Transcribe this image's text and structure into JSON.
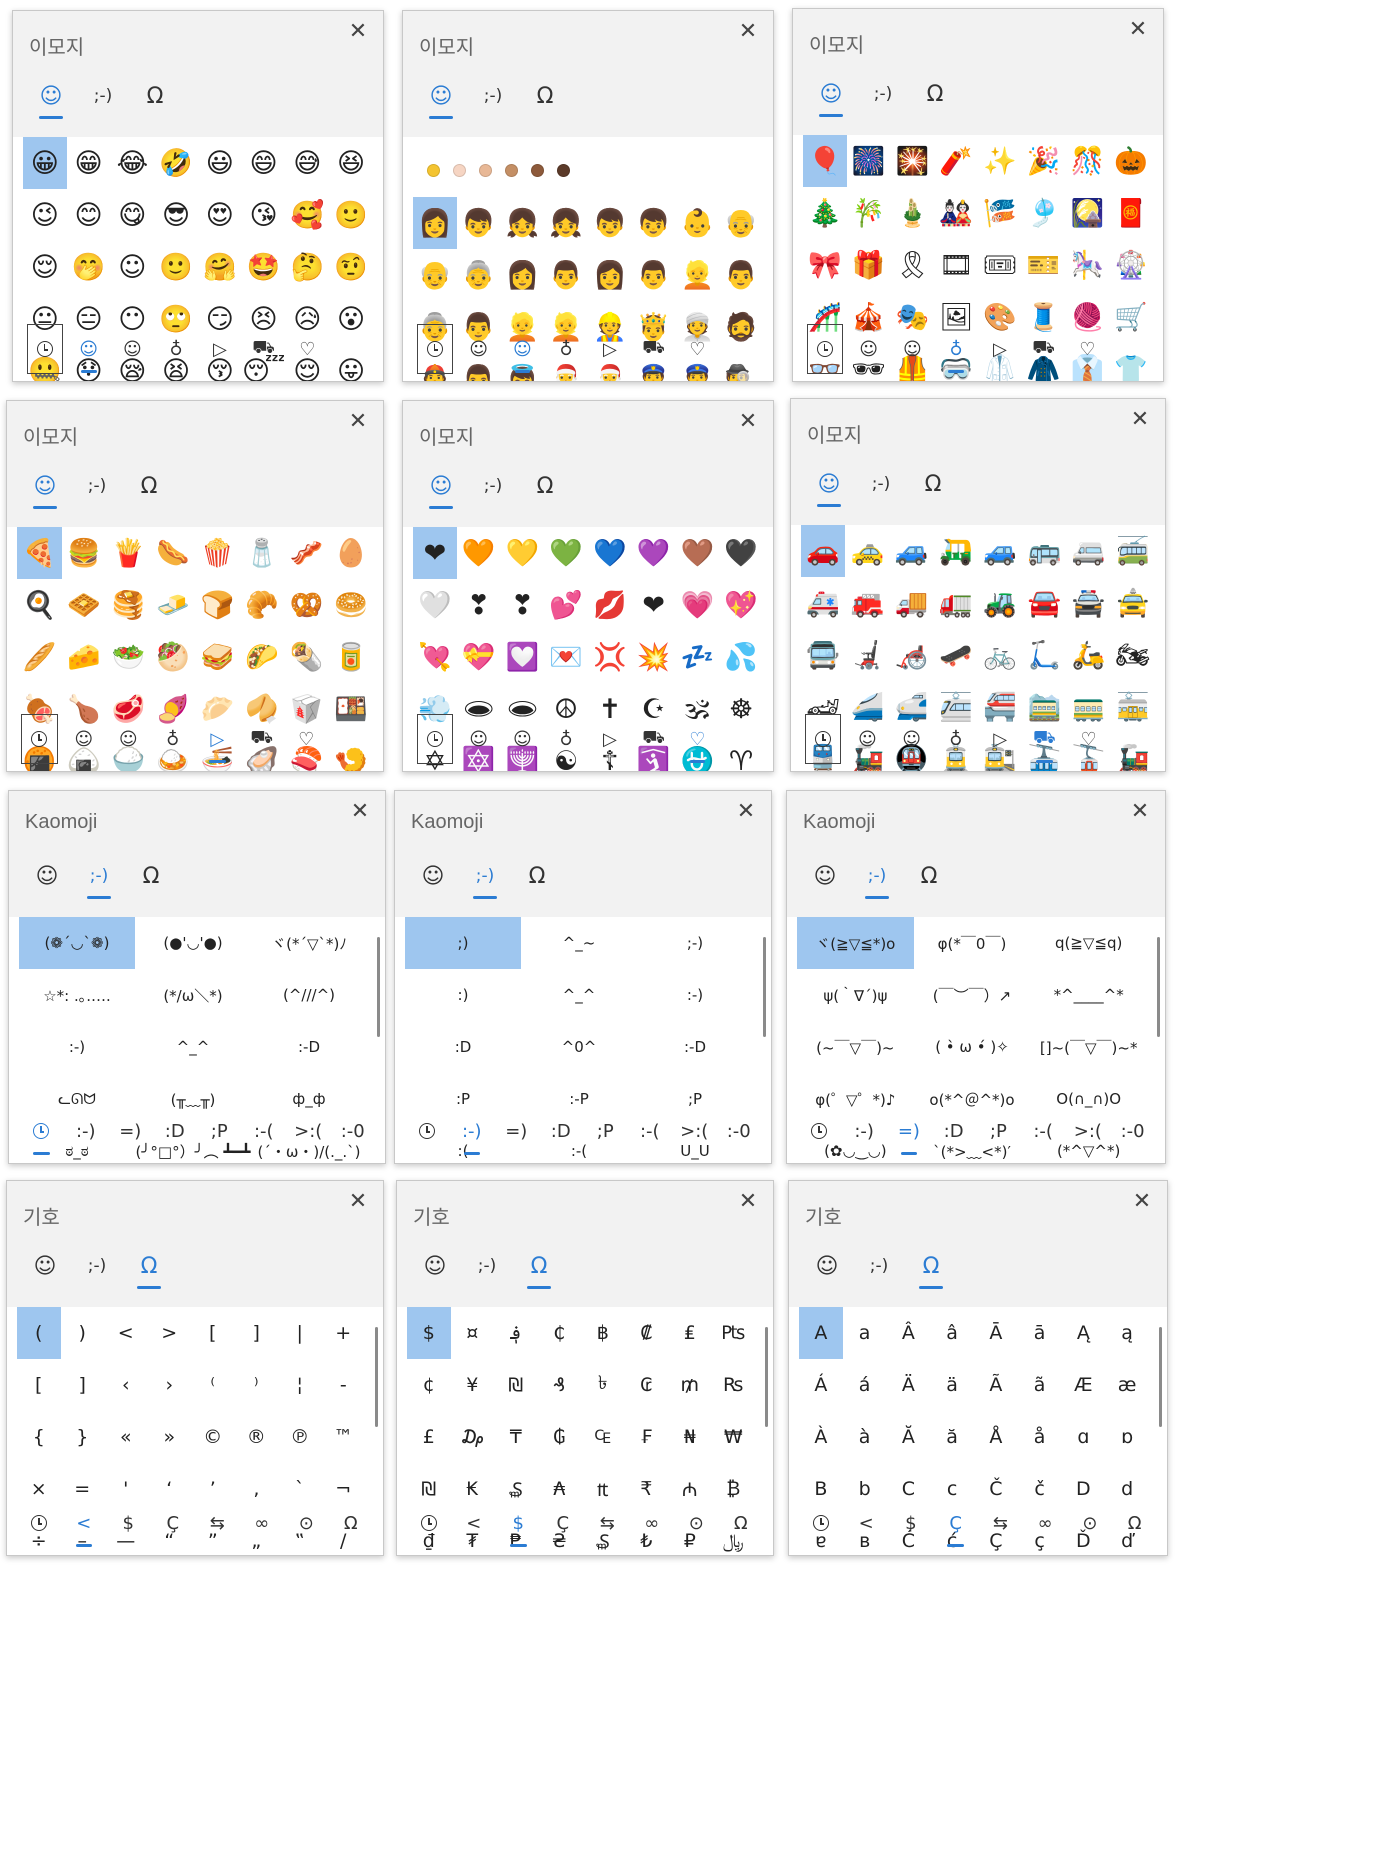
{
  "colors": {
    "accent": "#2b7cd3",
    "selected": "#9ec6ef"
  },
  "tabs": {
    "emoji_icon": "☺",
    "kaomoji_label": ";-)",
    "symbols_icon": "Ω"
  },
  "emoji_categories": [
    "recent-clock-icon",
    "smiley-icon",
    "person-icon",
    "balloon-icon",
    "pizza-icon",
    "car-icon",
    "heart-icon"
  ],
  "emoji_category_glyphs": [
    "",
    "☺",
    "☺",
    "♁",
    "▷",
    "⛟",
    "♡"
  ],
  "skin_tones": [
    "#f4c430",
    "#f6d5c3",
    "#e8b896",
    "#c48f65",
    "#8d5a3b",
    "#5b3a29"
  ],
  "kaomoji_categories": [
    "",
    ":-)",
    "=)",
    ":D",
    ";P",
    ":-(",
    ">:(",
    ":-0"
  ],
  "symbol_categories": [
    "",
    "<",
    "$",
    "Ç",
    "⇆",
    "∞",
    "⊙",
    "Ω"
  ],
  "panels": [
    {
      "title": "이모지",
      "tab": "emoji",
      "cat": 1,
      "tones": false,
      "rows": [
        [
          "😀",
          "😁",
          "😂",
          "🤣",
          "😃",
          "😄",
          "😅",
          "😆"
        ],
        [
          "😉",
          "😊",
          "😋",
          "😎",
          "😍",
          "😘",
          "🥰",
          "🙂"
        ],
        [
          "😌",
          "🤭",
          "☺",
          "🙂",
          "🤗",
          "🤩",
          "🤔",
          "🤨"
        ],
        [
          "😐",
          "😑",
          "😶",
          "🙄",
          "😏",
          "😣",
          "😥",
          "😮"
        ],
        [
          "🤐",
          "😯",
          "😪",
          "😫",
          "😚",
          "😴",
          "😌",
          "😛"
        ]
      ]
    },
    {
      "title": "이모지",
      "tab": "emoji",
      "cat": 2,
      "tones": true,
      "rows": [
        [
          "👩",
          "👦",
          "👧",
          "👧",
          "👦",
          "👦",
          "👶",
          "👴"
        ],
        [
          "👴",
          "👵",
          "👩",
          "👨",
          "👩",
          "👨",
          "👱",
          "👨"
        ],
        [
          "👵",
          "👨",
          "👱",
          "👱",
          "👷",
          "🤴",
          "👳",
          "🧔"
        ],
        [
          "👲",
          "👨",
          "👼",
          "🎅",
          "🎅",
          "👮",
          "👮",
          "🕵"
        ]
      ]
    },
    {
      "title": "이모지",
      "tab": "emoji",
      "cat": 3,
      "tones": false,
      "rows": [
        [
          "🎈",
          "🎆",
          "🎇",
          "🧨",
          "✨",
          "🎉",
          "🎊",
          "🎃"
        ],
        [
          "🎄",
          "🎋",
          "🎍",
          "🎎",
          "🎏",
          "🎐",
          "🎑",
          "🧧"
        ],
        [
          "🎀",
          "🎁",
          "🎗",
          "🎞",
          "🎟",
          "🎫",
          "🎠",
          "🎡"
        ],
        [
          "🎢",
          "🎪",
          "🎭",
          "🖼",
          "🎨",
          "🧵",
          "🧶",
          "🛒"
        ],
        [
          "👓",
          "🕶",
          "🦺",
          "🥽",
          "🥼",
          "🧥",
          "👔",
          "👕"
        ]
      ]
    },
    {
      "title": "이모지",
      "tab": "emoji",
      "cat": 4,
      "tones": false,
      "rows": [
        [
          "🍕",
          "🍔",
          "🍟",
          "🌭",
          "🍿",
          "🧂",
          "🥓",
          "🥚"
        ],
        [
          "🍳",
          "🧇",
          "🥞",
          "🧈",
          "🍞",
          "🥐",
          "🥨",
          "🥯"
        ],
        [
          "🥖",
          "🧀",
          "🥗",
          "🥙",
          "🥪",
          "🌮",
          "🌯",
          "🥫"
        ],
        [
          "🍖",
          "🍗",
          "🥩",
          "🍠",
          "🥟",
          "🥠",
          "🥡",
          "🍱"
        ],
        [
          "🍘",
          "🍙",
          "🍚",
          "🍛",
          "🍜",
          "🦪",
          "🍣",
          "🍤"
        ]
      ]
    },
    {
      "title": "이모지",
      "tab": "emoji",
      "cat": 6,
      "tones": false,
      "rows": [
        [
          "❤",
          "🧡",
          "💛",
          "💚",
          "💙",
          "💜",
          "🤎",
          "🖤"
        ],
        [
          "🤍",
          "❣",
          "❣",
          "💕",
          "💋",
          "❤",
          "💗",
          "💖"
        ],
        [
          "💘",
          "💝",
          "💟",
          "💌",
          "💢",
          "💥",
          "💤",
          "💦"
        ],
        [
          "💨",
          "🕳",
          "🕳",
          "☮",
          "✝",
          "☪",
          "🕉",
          "☸"
        ],
        [
          "✡",
          "🔯",
          "🕎",
          "☯",
          "☦",
          "🛐",
          "⛎",
          "♈"
        ]
      ]
    },
    {
      "title": "이모지",
      "tab": "emoji",
      "cat": 5,
      "tones": false,
      "rows": [
        [
          "🚗",
          "🚕",
          "🚙",
          "🛺",
          "🚙",
          "🚌",
          "🚐",
          "🚎"
        ],
        [
          "🚑",
          "🚒",
          "🚚",
          "🚛",
          "🚜",
          "🚘",
          "🚔",
          "🚖"
        ],
        [
          "🚍",
          "🦼",
          "🦽",
          "🛹",
          "🚲",
          "🛴",
          "🛵",
          "🏍"
        ],
        [
          "🏎",
          "🚄",
          "🚅",
          "🚈",
          "🚝",
          "🚞",
          "🚃",
          "🚋"
        ],
        [
          "🚆",
          "🚂",
          "🚇",
          "🚊",
          "🚉",
          "🚠",
          "🚡",
          "🚂"
        ]
      ]
    },
    {
      "title": "Kaomoji",
      "tab": "kaomoji",
      "cat": 0,
      "rows": [
        [
          "(❁´◡`❁)",
          "(●'◡'●)",
          "ヾ(*´▽`*)ﾉ"
        ],
        [
          "☆*: .｡.….",
          "(*/ω＼*)",
          "(^///^)"
        ],
        [
          ":-)",
          "^_^",
          ":-D"
        ],
        [
          "ᓚᘏᗢ",
          "(╥﹏╥)",
          "ф_ф"
        ],
        [
          "ಠ_ಠ",
          "(╯°□°）╯︵ ┻━┻",
          "(ˊ・ω・)/(._.`)"
        ]
      ]
    },
    {
      "title": "Kaomoji",
      "tab": "kaomoji",
      "cat": 1,
      "rows": [
        [
          ";)",
          "^_~",
          ";-)"
        ],
        [
          ":)",
          "^_^",
          ":-)"
        ],
        [
          ":D",
          "^0^",
          ":-D"
        ],
        [
          ":P",
          ":-P",
          ";P"
        ],
        [
          ":(",
          ":-(",
          "U_U"
        ]
      ]
    },
    {
      "title": "Kaomoji",
      "tab": "kaomoji",
      "cat": 2,
      "rows": [
        [
          "ヾ(≧▽≦*)o",
          "φ(*￣0￣)",
          "q(≧▽≦q)"
        ],
        [
          "ψ(｀∇´)ψ",
          "(￣︶￣）↗",
          "*^____^*"
        ],
        [
          "(~￣▽￣)~",
          "( •̀ ω •́ )✧",
          "[]~(￣▽￣)~*"
        ],
        [
          "φ(゜▽゜*)♪",
          "o(*^＠^*)o",
          "O(∩_∩)O"
        ],
        [
          "(✿◡‿◡)",
          "`(*>﹏<*)′",
          "(*^▽^*)"
        ]
      ]
    },
    {
      "title": "기호",
      "tab": "symbols",
      "cat": 1,
      "rows": [
        [
          "(",
          ")",
          "<",
          ">",
          "[",
          "]",
          "|",
          "+"
        ],
        [
          "[",
          "]",
          "‹",
          "›",
          "⁽",
          "⁾",
          "¦",
          "-"
        ],
        [
          "{",
          "}",
          "«",
          "»",
          "©",
          "®",
          "℗",
          "™"
        ],
        [
          "×",
          "=",
          "'",
          "‘",
          "’",
          "‚",
          "`",
          "¬"
        ],
        [
          "÷",
          "–",
          "—",
          "“",
          "”",
          "„",
          "‟",
          "/"
        ]
      ]
    },
    {
      "title": "기호",
      "tab": "symbols",
      "cat": 2,
      "rows": [
        [
          "$",
          "¤",
          "؋",
          "₵",
          "฿",
          "₡",
          "₤",
          "₧"
        ],
        [
          "¢",
          "¥",
          "₪",
          "₰",
          "৳",
          "₢",
          "₥",
          "₨"
        ],
        [
          "£",
          "₯",
          "₸",
          "₲",
          "₠",
          "₣",
          "₦",
          "₩"
        ],
        [
          "₪",
          "₭",
          "₷",
          "₳",
          "₶",
          "₹",
          "₼",
          "₿"
        ],
        [
          "₫",
          "₮",
          "₱",
          "₴",
          "₷",
          "₺",
          "₽",
          "﷼"
        ]
      ]
    },
    {
      "title": "기호",
      "tab": "symbols",
      "cat": 3,
      "rows": [
        [
          "A",
          "a",
          "Â",
          "â",
          "Ā",
          "ā",
          "Ą",
          "ą"
        ],
        [
          "Á",
          "á",
          "Ä",
          "ä",
          "Ã",
          "ã",
          "Æ",
          "æ"
        ],
        [
          "À",
          "à",
          "Ă",
          "ă",
          "Å",
          "å",
          "ɑ",
          "ɒ"
        ],
        [
          "B",
          "b",
          "C",
          "c",
          "Č",
          "č",
          "D",
          "d"
        ],
        [
          "ɐ",
          "ʙ",
          "Ć",
          "ć",
          "Ç",
          "ç",
          "Ď",
          "ď"
        ]
      ]
    }
  ]
}
